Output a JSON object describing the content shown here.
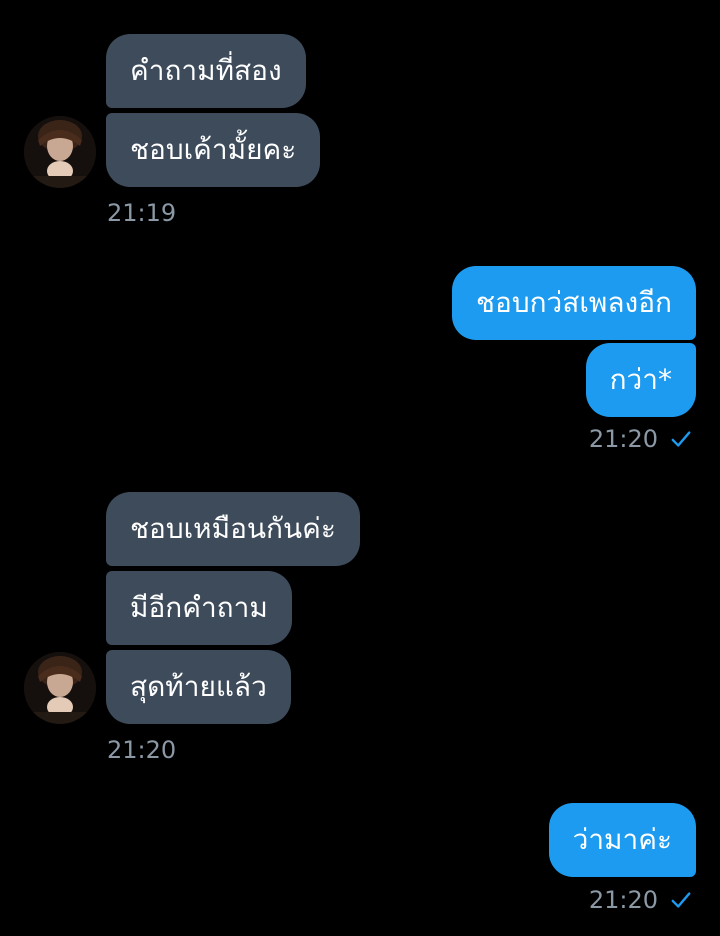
{
  "colors": {
    "background": "#000000",
    "incoming_bubble": "#3d4b5b",
    "outgoing_bubble": "#1d9bf0",
    "timestamp": "#8b98a5",
    "read_check": "#1d9bf0"
  },
  "messages": {
    "group1": {
      "msg1": "คำถามที่สอง",
      "msg2": "ชอบเค้ามั้ยคะ",
      "time": "21:19"
    },
    "group2": {
      "msg1": "ชอบกว่สเพลงอีก",
      "msg2": "กว่า*",
      "time": "21:20",
      "status_icon": "check-icon"
    },
    "group3": {
      "msg1": "ชอบเหมือนกันค่ะ",
      "msg2": "มีอีกคำถาม",
      "msg3": "สุดท้ายแล้ว",
      "time": "21:20"
    },
    "group4": {
      "msg1": "ว่ามาค่ะ",
      "time": "21:20",
      "status_icon": "check-icon"
    }
  }
}
